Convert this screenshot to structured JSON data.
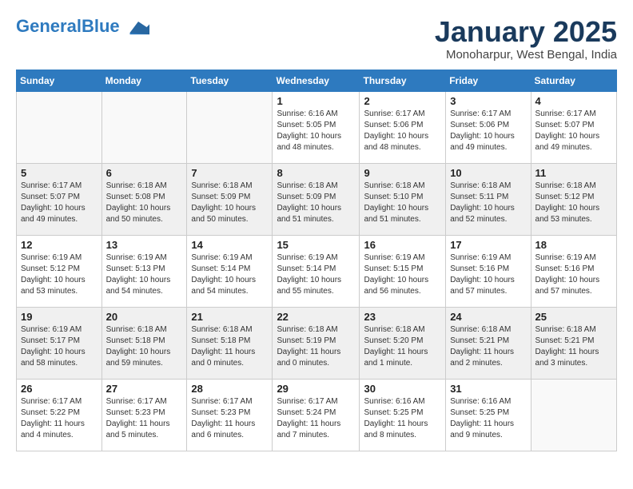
{
  "logo": {
    "line1": "General",
    "line2": "Blue"
  },
  "title": "January 2025",
  "subtitle": "Monoharpur, West Bengal, India",
  "weekdays": [
    "Sunday",
    "Monday",
    "Tuesday",
    "Wednesday",
    "Thursday",
    "Friday",
    "Saturday"
  ],
  "weeks": [
    [
      {
        "day": "",
        "info": ""
      },
      {
        "day": "",
        "info": ""
      },
      {
        "day": "",
        "info": ""
      },
      {
        "day": "1",
        "info": "Sunrise: 6:16 AM\nSunset: 5:05 PM\nDaylight: 10 hours\nand 48 minutes."
      },
      {
        "day": "2",
        "info": "Sunrise: 6:17 AM\nSunset: 5:06 PM\nDaylight: 10 hours\nand 48 minutes."
      },
      {
        "day": "3",
        "info": "Sunrise: 6:17 AM\nSunset: 5:06 PM\nDaylight: 10 hours\nand 49 minutes."
      },
      {
        "day": "4",
        "info": "Sunrise: 6:17 AM\nSunset: 5:07 PM\nDaylight: 10 hours\nand 49 minutes."
      }
    ],
    [
      {
        "day": "5",
        "info": "Sunrise: 6:17 AM\nSunset: 5:07 PM\nDaylight: 10 hours\nand 49 minutes."
      },
      {
        "day": "6",
        "info": "Sunrise: 6:18 AM\nSunset: 5:08 PM\nDaylight: 10 hours\nand 50 minutes."
      },
      {
        "day": "7",
        "info": "Sunrise: 6:18 AM\nSunset: 5:09 PM\nDaylight: 10 hours\nand 50 minutes."
      },
      {
        "day": "8",
        "info": "Sunrise: 6:18 AM\nSunset: 5:09 PM\nDaylight: 10 hours\nand 51 minutes."
      },
      {
        "day": "9",
        "info": "Sunrise: 6:18 AM\nSunset: 5:10 PM\nDaylight: 10 hours\nand 51 minutes."
      },
      {
        "day": "10",
        "info": "Sunrise: 6:18 AM\nSunset: 5:11 PM\nDaylight: 10 hours\nand 52 minutes."
      },
      {
        "day": "11",
        "info": "Sunrise: 6:18 AM\nSunset: 5:12 PM\nDaylight: 10 hours\nand 53 minutes."
      }
    ],
    [
      {
        "day": "12",
        "info": "Sunrise: 6:19 AM\nSunset: 5:12 PM\nDaylight: 10 hours\nand 53 minutes."
      },
      {
        "day": "13",
        "info": "Sunrise: 6:19 AM\nSunset: 5:13 PM\nDaylight: 10 hours\nand 54 minutes."
      },
      {
        "day": "14",
        "info": "Sunrise: 6:19 AM\nSunset: 5:14 PM\nDaylight: 10 hours\nand 54 minutes."
      },
      {
        "day": "15",
        "info": "Sunrise: 6:19 AM\nSunset: 5:14 PM\nDaylight: 10 hours\nand 55 minutes."
      },
      {
        "day": "16",
        "info": "Sunrise: 6:19 AM\nSunset: 5:15 PM\nDaylight: 10 hours\nand 56 minutes."
      },
      {
        "day": "17",
        "info": "Sunrise: 6:19 AM\nSunset: 5:16 PM\nDaylight: 10 hours\nand 57 minutes."
      },
      {
        "day": "18",
        "info": "Sunrise: 6:19 AM\nSunset: 5:16 PM\nDaylight: 10 hours\nand 57 minutes."
      }
    ],
    [
      {
        "day": "19",
        "info": "Sunrise: 6:19 AM\nSunset: 5:17 PM\nDaylight: 10 hours\nand 58 minutes."
      },
      {
        "day": "20",
        "info": "Sunrise: 6:18 AM\nSunset: 5:18 PM\nDaylight: 10 hours\nand 59 minutes."
      },
      {
        "day": "21",
        "info": "Sunrise: 6:18 AM\nSunset: 5:18 PM\nDaylight: 11 hours\nand 0 minutes."
      },
      {
        "day": "22",
        "info": "Sunrise: 6:18 AM\nSunset: 5:19 PM\nDaylight: 11 hours\nand 0 minutes."
      },
      {
        "day": "23",
        "info": "Sunrise: 6:18 AM\nSunset: 5:20 PM\nDaylight: 11 hours\nand 1 minute."
      },
      {
        "day": "24",
        "info": "Sunrise: 6:18 AM\nSunset: 5:21 PM\nDaylight: 11 hours\nand 2 minutes."
      },
      {
        "day": "25",
        "info": "Sunrise: 6:18 AM\nSunset: 5:21 PM\nDaylight: 11 hours\nand 3 minutes."
      }
    ],
    [
      {
        "day": "26",
        "info": "Sunrise: 6:17 AM\nSunset: 5:22 PM\nDaylight: 11 hours\nand 4 minutes."
      },
      {
        "day": "27",
        "info": "Sunrise: 6:17 AM\nSunset: 5:23 PM\nDaylight: 11 hours\nand 5 minutes."
      },
      {
        "day": "28",
        "info": "Sunrise: 6:17 AM\nSunset: 5:23 PM\nDaylight: 11 hours\nand 6 minutes."
      },
      {
        "day": "29",
        "info": "Sunrise: 6:17 AM\nSunset: 5:24 PM\nDaylight: 11 hours\nand 7 minutes."
      },
      {
        "day": "30",
        "info": "Sunrise: 6:16 AM\nSunset: 5:25 PM\nDaylight: 11 hours\nand 8 minutes."
      },
      {
        "day": "31",
        "info": "Sunrise: 6:16 AM\nSunset: 5:25 PM\nDaylight: 11 hours\nand 9 minutes."
      },
      {
        "day": "",
        "info": ""
      }
    ]
  ]
}
